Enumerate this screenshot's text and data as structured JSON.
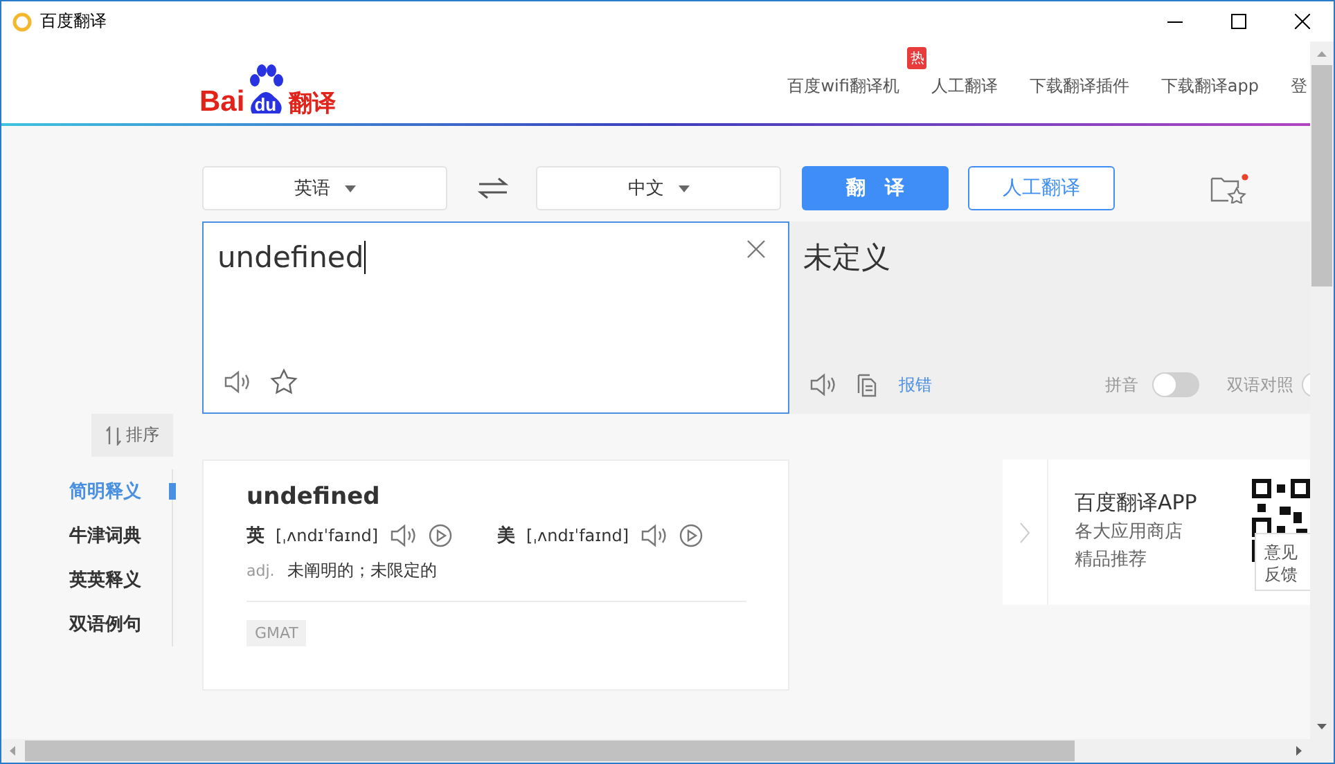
{
  "window": {
    "title": "百度翻译"
  },
  "logo": {
    "part_1": "Bai",
    "part_2": "du",
    "suffix": "翻译"
  },
  "nav": [
    {
      "label": "百度wifi翻译机",
      "badge": "热"
    },
    {
      "label": "人工翻译"
    },
    {
      "label": "下载翻译插件"
    },
    {
      "label": "下载翻译app"
    },
    {
      "label": "登"
    }
  ],
  "toolbar": {
    "source_language": "英语",
    "target_language": "中文",
    "translate_button": "翻　译",
    "human_button": "人工翻译"
  },
  "input": {
    "value": "undefined"
  },
  "output": {
    "text": "未定义",
    "report_link": "报错",
    "pinyin": {
      "label": "拼音",
      "on": false
    },
    "bilingual": {
      "label": "双语对照",
      "on": false
    }
  },
  "sort_button": "排序",
  "sections": [
    {
      "label": "简明释义",
      "selected": true
    },
    {
      "label": "牛津词典",
      "selected": false
    },
    {
      "label": "英英释义",
      "selected": false
    },
    {
      "label": "双语例句",
      "selected": false
    }
  ],
  "dictionary": {
    "word": "undefined",
    "phonetics": [
      {
        "region": "英",
        "ipa": "[ˌʌndɪˈfaɪnd]"
      },
      {
        "region": "美",
        "ipa": "[ˌʌndɪˈfaɪnd]"
      }
    ],
    "definition": {
      "pos": "adj.",
      "meaning": "未阐明的；未限定的"
    },
    "tags": [
      "GMAT"
    ]
  },
  "ad": {
    "title": "百度翻译APP",
    "line_1": "各大应用商店",
    "line_2": "精品推荐"
  },
  "feedback": {
    "line_1": "意见",
    "line_2": "反馈"
  }
}
